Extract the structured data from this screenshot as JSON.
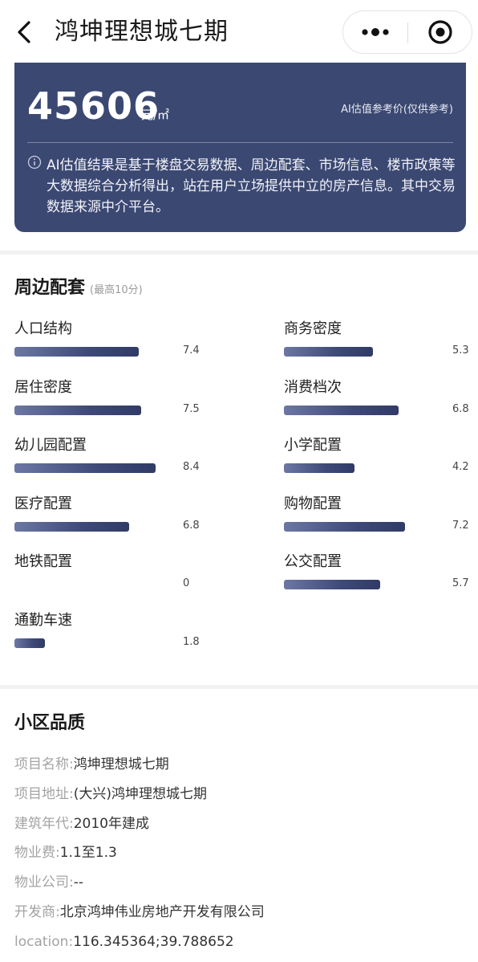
{
  "header": {
    "title": "鸿坤理想城七期",
    "back_icon": "chevron-left-icon",
    "more_icon": "more-dots-icon",
    "close_icon": "target-circle-icon"
  },
  "price_card": {
    "value": "45606",
    "unit": "元/㎡",
    "reference_label": "AI估值参考价(仅供参考)",
    "note": "AI估值结果是基于楼盘交易数据、周边配套、市场信息、楼市政策等大数据综合分析得出，站在用户立场提供中立的房产信息。其中交易数据来源中介平台。",
    "bg_color": "#3b4872"
  },
  "amenities": {
    "title": "周边配套",
    "subtitle": "(最高10分)",
    "max_score": 10,
    "items": [
      {
        "label": "人口结构",
        "value": "7.4",
        "score": 7.4
      },
      {
        "label": "商务密度",
        "value": "5.3",
        "score": 5.3
      },
      {
        "label": "居住密度",
        "value": "7.5",
        "score": 7.5
      },
      {
        "label": "消费档次",
        "value": "6.8",
        "score": 6.8
      },
      {
        "label": "幼儿园配置",
        "value": "8.4",
        "score": 8.4
      },
      {
        "label": "小学配置",
        "value": "4.2",
        "score": 4.2
      },
      {
        "label": "医疗配置",
        "value": "6.8",
        "score": 6.8
      },
      {
        "label": "购物配置",
        "value": "7.2",
        "score": 7.2
      },
      {
        "label": "地铁配置",
        "value": "0",
        "score": 0
      },
      {
        "label": "公交配置",
        "value": "5.7",
        "score": 5.7
      },
      {
        "label": "通勤车速",
        "value": "1.8",
        "score": 1.8
      }
    ]
  },
  "quality": {
    "title": "小区品质",
    "rows": [
      {
        "key": "项目名称:",
        "value": "鸿坤理想城七期"
      },
      {
        "key": "项目地址:",
        "value": "(大兴)鸿坤理想城七期"
      },
      {
        "key": "建筑年代:",
        "value": "2010年建成"
      },
      {
        "key": "物业费:",
        "value": "1.1至1.3"
      },
      {
        "key": "物业公司:",
        "value": "--"
      },
      {
        "key": "开发商:",
        "value": "北京鸿坤伟业房地产开发有限公司"
      },
      {
        "key": "location:",
        "value": "116.345364;39.788652"
      }
    ]
  }
}
